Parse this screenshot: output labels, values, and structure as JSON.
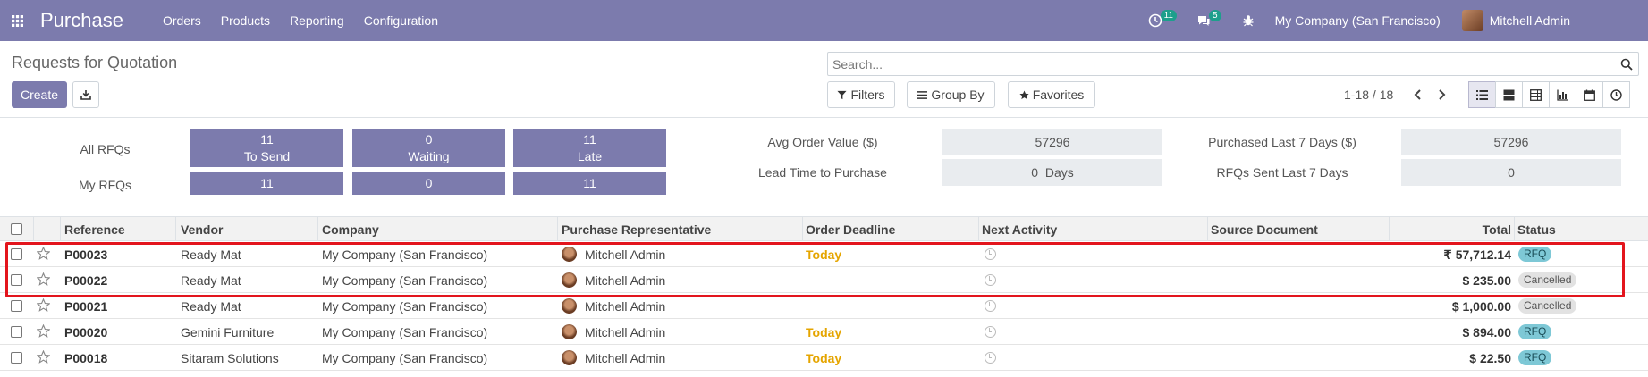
{
  "navbar": {
    "app_name": "Purchase",
    "menu": [
      "Orders",
      "Products",
      "Reporting",
      "Configuration"
    ],
    "activity_count": "11",
    "message_count": "5",
    "company": "My Company (San Francisco)",
    "user": "Mitchell Admin",
    "color": "#7c7bad"
  },
  "control_panel": {
    "title": "Requests for Quotation",
    "create_label": "Create",
    "search_placeholder": "Search...",
    "filters_label": "Filters",
    "group_by_label": "Group By",
    "favorites_label": "Favorites",
    "pager": "1-18 / 18",
    "views": [
      "list-view-icon",
      "kanban-view-icon",
      "pivot-view-icon",
      "graph-view-icon",
      "calendar-view-icon",
      "activity-view-icon"
    ]
  },
  "dashboard": {
    "all_rfqs_label": "All RFQs",
    "my_rfqs_label": "My RFQs",
    "tiles_all": [
      {
        "count": "11",
        "label": "To Send"
      },
      {
        "count": "0",
        "label": "Waiting"
      },
      {
        "count": "11",
        "label": "Late"
      }
    ],
    "tiles_my": [
      "11",
      "0",
      "11"
    ],
    "avg_order_label": "Avg Order Value ($)",
    "avg_order_value": "57296",
    "lead_time_label": "Lead Time to Purchase",
    "lead_time_value": "0  Days",
    "purchased_label": "Purchased Last 7 Days ($)",
    "purchased_value": "57296",
    "rfqs_sent_label": "RFQs Sent Last 7 Days",
    "rfqs_sent_value": "0"
  },
  "table": {
    "headers": {
      "reference": "Reference",
      "vendor": "Vendor",
      "company": "Company",
      "rep": "Purchase Representative",
      "deadline": "Order Deadline",
      "activity": "Next Activity",
      "source": "Source Document",
      "total": "Total",
      "status": "Status"
    },
    "rows": [
      {
        "reference": "P00023",
        "vendor": "Ready Mat",
        "company": "My Company (San Francisco)",
        "rep": "Mitchell Admin",
        "deadline": "Today",
        "source": "",
        "total": "₹ 57,712.14",
        "status": "RFQ"
      },
      {
        "reference": "P00022",
        "vendor": "Ready Mat",
        "company": "My Company (San Francisco)",
        "rep": "Mitchell Admin",
        "deadline": "",
        "source": "",
        "total": "$ 235.00",
        "status": "Cancelled"
      },
      {
        "reference": "P00021",
        "vendor": "Ready Mat",
        "company": "My Company (San Francisco)",
        "rep": "Mitchell Admin",
        "deadline": "",
        "source": "",
        "total": "$ 1,000.00",
        "status": "Cancelled"
      },
      {
        "reference": "P00020",
        "vendor": "Gemini Furniture",
        "company": "My Company (San Francisco)",
        "rep": "Mitchell Admin",
        "deadline": "Today",
        "source": "",
        "total": "$ 894.00",
        "status": "RFQ"
      },
      {
        "reference": "P00018",
        "vendor": "Sitaram Solutions",
        "company": "My Company (San Francisco)",
        "rep": "Mitchell Admin",
        "deadline": "Today",
        "source": "",
        "total": "$ 22.50",
        "status": "RFQ"
      }
    ]
  },
  "colors": {
    "today": "#e5a500",
    "rfq_badge": "#7ec8d6",
    "cancelled_badge": "#e2e2e2",
    "highlight": "#e3151d"
  }
}
